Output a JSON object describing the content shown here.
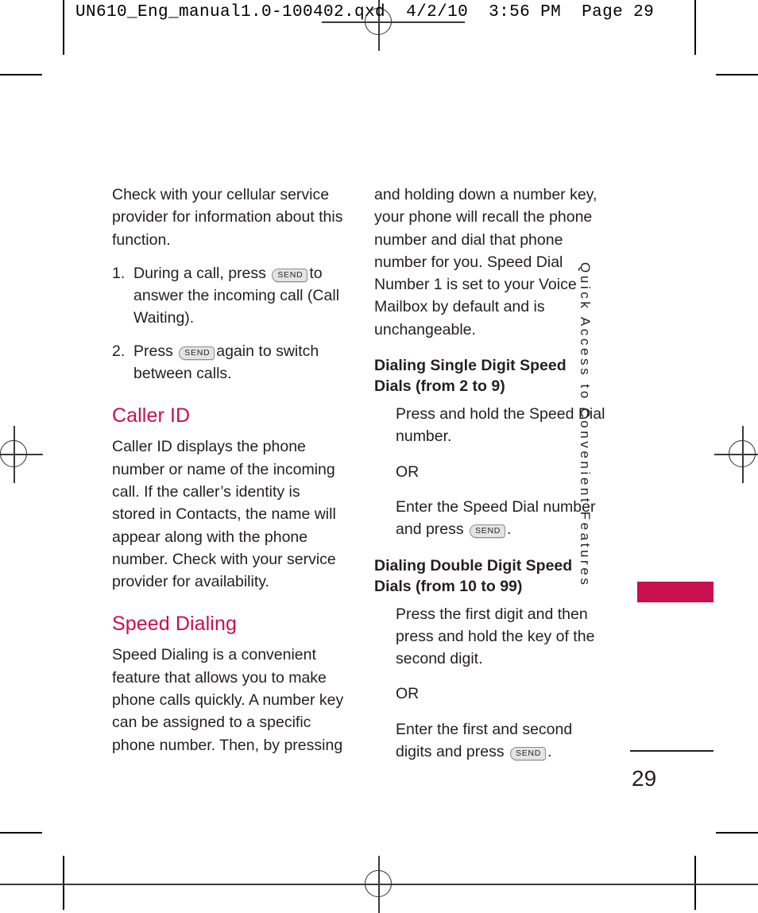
{
  "prepress": {
    "header_line": "UN610_Eng_manual1.0-100402.qxd  4/2/10  3:56 PM  Page 29"
  },
  "accent_color": "#c8104e",
  "text_color": "#231f20",
  "key_glyph": {
    "send_label": "SEND"
  },
  "left_column": {
    "intro_paragraph": "Check with your cellular service provider for information about this function.",
    "numbered_steps": [
      {
        "number": "1.",
        "text_before_key": "During a call, press",
        "key": "SEND",
        "text_after_key": "to answer the incoming call (Call Waiting)."
      },
      {
        "number": "2.",
        "text_before_key": "Press",
        "key": "SEND",
        "text_after_key": "again to switch between calls."
      }
    ],
    "caller_id": {
      "heading": "Caller ID",
      "body": "Caller ID displays the phone number or name of the incoming call. If the caller’s identity is stored in Contacts, the name will appear along with the phone number. Check with your service provider for availability."
    },
    "speed_dialing": {
      "heading": "Speed Dialing",
      "body": "Speed Dialing is a convenient feature that allows you to make phone calls quickly. A number key can be assigned to a specific phone number. Then, by pressing"
    }
  },
  "right_column": {
    "continued_paragraph": "and holding down a number key, your phone will recall the phone number and dial that phone number for you. Speed Dial Number 1 is set to your Voice Mailbox by default and is unchangeable.",
    "single_digit": {
      "heading": "Dialing Single Digit Speed Dials (from 2 to 9)",
      "step_1": "Press and hold the Speed Dial number.",
      "or_label": "OR",
      "step_2_before_key": "Enter the Speed Dial number and press",
      "step_2_key": "SEND",
      "step_2_after_key": "."
    },
    "double_digit": {
      "heading": "Dialing Double Digit Speed Dials (from 10 to 99)",
      "step_1": "Press the first digit and then press and hold the key of the second digit.",
      "or_label": "OR",
      "step_2_before_key": "Enter the first and second digits and press",
      "step_2_key": "SEND",
      "step_2_after_key": "."
    }
  },
  "running_head": {
    "text": "Quick Access to Convenient Features"
  },
  "folio": {
    "page_number": "29"
  }
}
